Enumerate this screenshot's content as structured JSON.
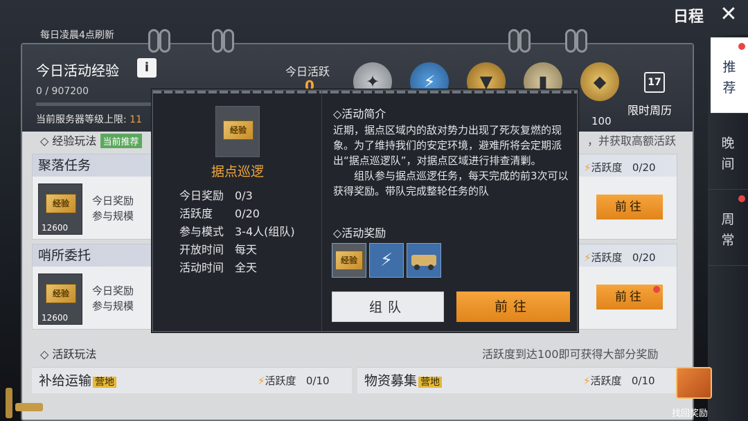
{
  "header": {
    "title": "日程",
    "close_label": "✕",
    "refresh_note": "每日凌晨4点刷新"
  },
  "exp": {
    "title": "今日活动经验",
    "info_label": "i",
    "value": "0",
    "max": "/ 907200",
    "server_level_label": "当前服务器等级上限:",
    "server_level_value": "11"
  },
  "activity": {
    "label": "今日活跃",
    "value": "0",
    "milestone": "100",
    "weekly_label": "限时周历",
    "calendar_day": "17"
  },
  "sections": {
    "exp_play": {
      "title": "◇ 经验玩法",
      "tag": "当前推荐",
      "note": "，并获取高额活跃"
    },
    "active_play": {
      "title": "◇ 活跃玩法",
      "note": "活跃度到达100即可获得大部分奖励"
    }
  },
  "cards": [
    {
      "title": "聚落任务",
      "ticket": "经验",
      "num": "12600",
      "reward_label": "今日奖励",
      "scale_label": "参与规模",
      "activity_label": "活跃度",
      "activity_value": "0/20",
      "go": "前往"
    },
    {
      "title": "哨所委托",
      "ticket": "经验",
      "num": "12600",
      "reward_label": "今日奖励",
      "scale_label": "参与规模",
      "activity_label": "活跃度",
      "activity_value": "0/20",
      "go": "前往"
    }
  ],
  "bottom_cards": [
    {
      "name": "补给运输",
      "tag": "营地",
      "activity_label": "活跃度",
      "activity_value": "0/10"
    },
    {
      "name": "物资募集",
      "tag": "营地",
      "activity_label": "活跃度",
      "activity_value": "0/10"
    }
  ],
  "side_tabs": [
    {
      "label": "推\n荐",
      "active": true
    },
    {
      "label": "晚\n间",
      "active": false
    },
    {
      "label": "周\n常",
      "active": false
    }
  ],
  "gift": {
    "label": "找回奖励"
  },
  "modal": {
    "icon_text": "经验",
    "name": "据点巡逻",
    "rows": [
      {
        "k": "今日奖励",
        "v": "0/3"
      },
      {
        "k": "活跃度",
        "v": "0/20"
      },
      {
        "k": "参与模式",
        "v": "3-4人(组队)"
      },
      {
        "k": "开放时间",
        "v": "每天"
      },
      {
        "k": "活动时间",
        "v": "全天"
      }
    ],
    "intro_title": "◇活动简介",
    "intro_p1": "近期，据点区域内的敌对势力出现了死灰复燃的现象。为了维持我们的安定环境，避难所将会定期派出“据点巡逻队”，对据点区域进行排查清剿。",
    "intro_p2": "组队参与据点巡逻任务，每天完成的前3次可以获得奖励。带队完成整轮任务的队",
    "reward_title": "◇活动奖励",
    "reward_1": "经验",
    "team_btn": "组队",
    "go_btn": "前往"
  }
}
